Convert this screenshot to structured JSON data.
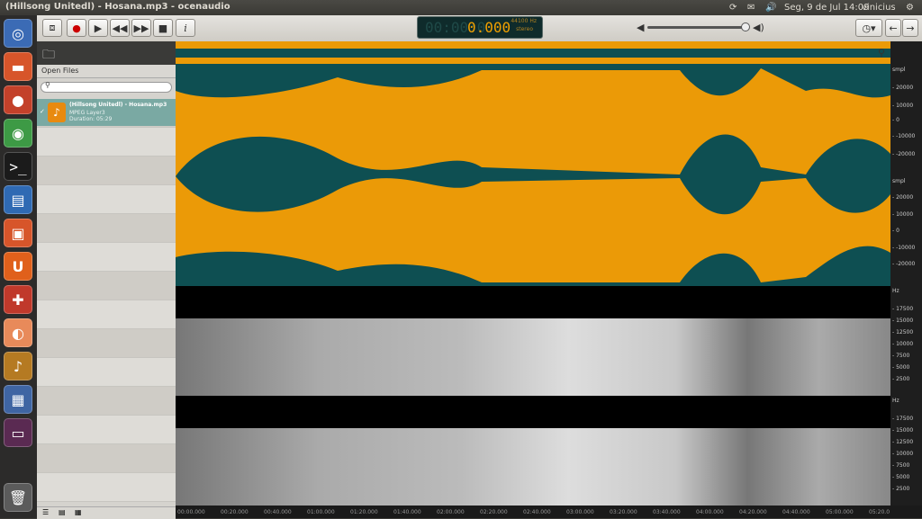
{
  "window": {
    "title": "(Hillsong Unitedl) - Hosana.mp3 - ocenaudio"
  },
  "tray": {
    "datetime": "Seg, 9 de Jul 14:09",
    "user": "vinicius"
  },
  "launcher": {
    "icons": [
      "ubuntu-home-icon",
      "files-icon",
      "firefox-icon",
      "chrome-icon",
      "terminal-icon",
      "writer-icon",
      "software-center-icon",
      "ubuntu-one-icon",
      "system-settings-icon",
      "app-icon",
      "ocenaudio-icon",
      "workspace-icon",
      "workspace2-icon",
      "trash-icon"
    ]
  },
  "lcd": {
    "time_ghost": "00:00:0",
    "time": "0.000",
    "rate": "44100 Hz",
    "channels": "stereo"
  },
  "sidebar": {
    "header": "Open Files",
    "files": [
      {
        "name": "(Hillsong Unitedl) - Hosana.mp3",
        "format": "MPEG Layer3",
        "duration": "Duration: 05:29"
      }
    ]
  },
  "ruler": {
    "wave_top": [
      "smpl",
      "- 20000",
      "- 10000",
      "- 0",
      "- -10000",
      "- -20000"
    ],
    "wave_bottom": [
      "smpl",
      "- 20000",
      "- 10000",
      "- 0",
      "- -10000",
      "- -20000"
    ],
    "spec": [
      "Hz",
      "- 17500",
      "- 15000",
      "- 12500",
      "- 10000",
      "- 7500",
      "- 5000",
      "- 2500"
    ]
  },
  "timeline": {
    "ticks": [
      "00:00.000",
      "00:20.000",
      "00:40.000",
      "01:00.000",
      "01:20.000",
      "01:40.000",
      "02:00.000",
      "02:20.000",
      "02:40.000",
      "03:00.000",
      "03:20.000",
      "03:40.000",
      "04:00.000",
      "04:20.000",
      "04:40.000",
      "05:00.000",
      "05:20.0"
    ]
  },
  "colors": {
    "waveform_bg": "#eb9a07",
    "waveform": "#0e4f52",
    "lcd_text": "#f0a000",
    "selected_file": "#7aa9a3"
  }
}
